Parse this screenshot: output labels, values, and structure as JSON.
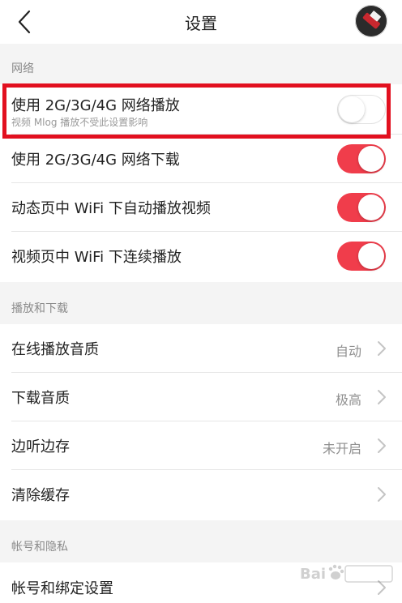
{
  "header": {
    "title": "设置"
  },
  "sections": {
    "network": "网络",
    "playback": "播放和下载",
    "account": "帐号和隐私"
  },
  "rows": {
    "play_mobile": {
      "label": "使用 2G/3G/4G 网络播放",
      "sublabel": "视频 Mlog 播放不受此设置影响",
      "toggle": "off"
    },
    "download_mobile": {
      "label": "使用 2G/3G/4G 网络下载",
      "toggle": "on"
    },
    "feed_autoplay": {
      "label": "动态页中 WiFi 下自动播放视频",
      "toggle": "on"
    },
    "video_continuous": {
      "label": "视频页中 WiFi 下连续播放",
      "toggle": "on"
    },
    "online_quality": {
      "label": "在线播放音质",
      "value": "自动"
    },
    "download_quality": {
      "label": "下载音质",
      "value": "极高"
    },
    "cache_while_listening": {
      "label": "边听边存",
      "value": "未开启"
    },
    "clear_cache": {
      "label": "清除缓存"
    },
    "account_binding": {
      "label": "帐号和绑定设置"
    }
  },
  "colors": {
    "toggle_on": "#f03d4b",
    "highlight": "#e2101f",
    "background": "#f4f4f4"
  },
  "icons": {
    "back": "chevron-left-icon",
    "row_arrow": "chevron-right-icon"
  }
}
